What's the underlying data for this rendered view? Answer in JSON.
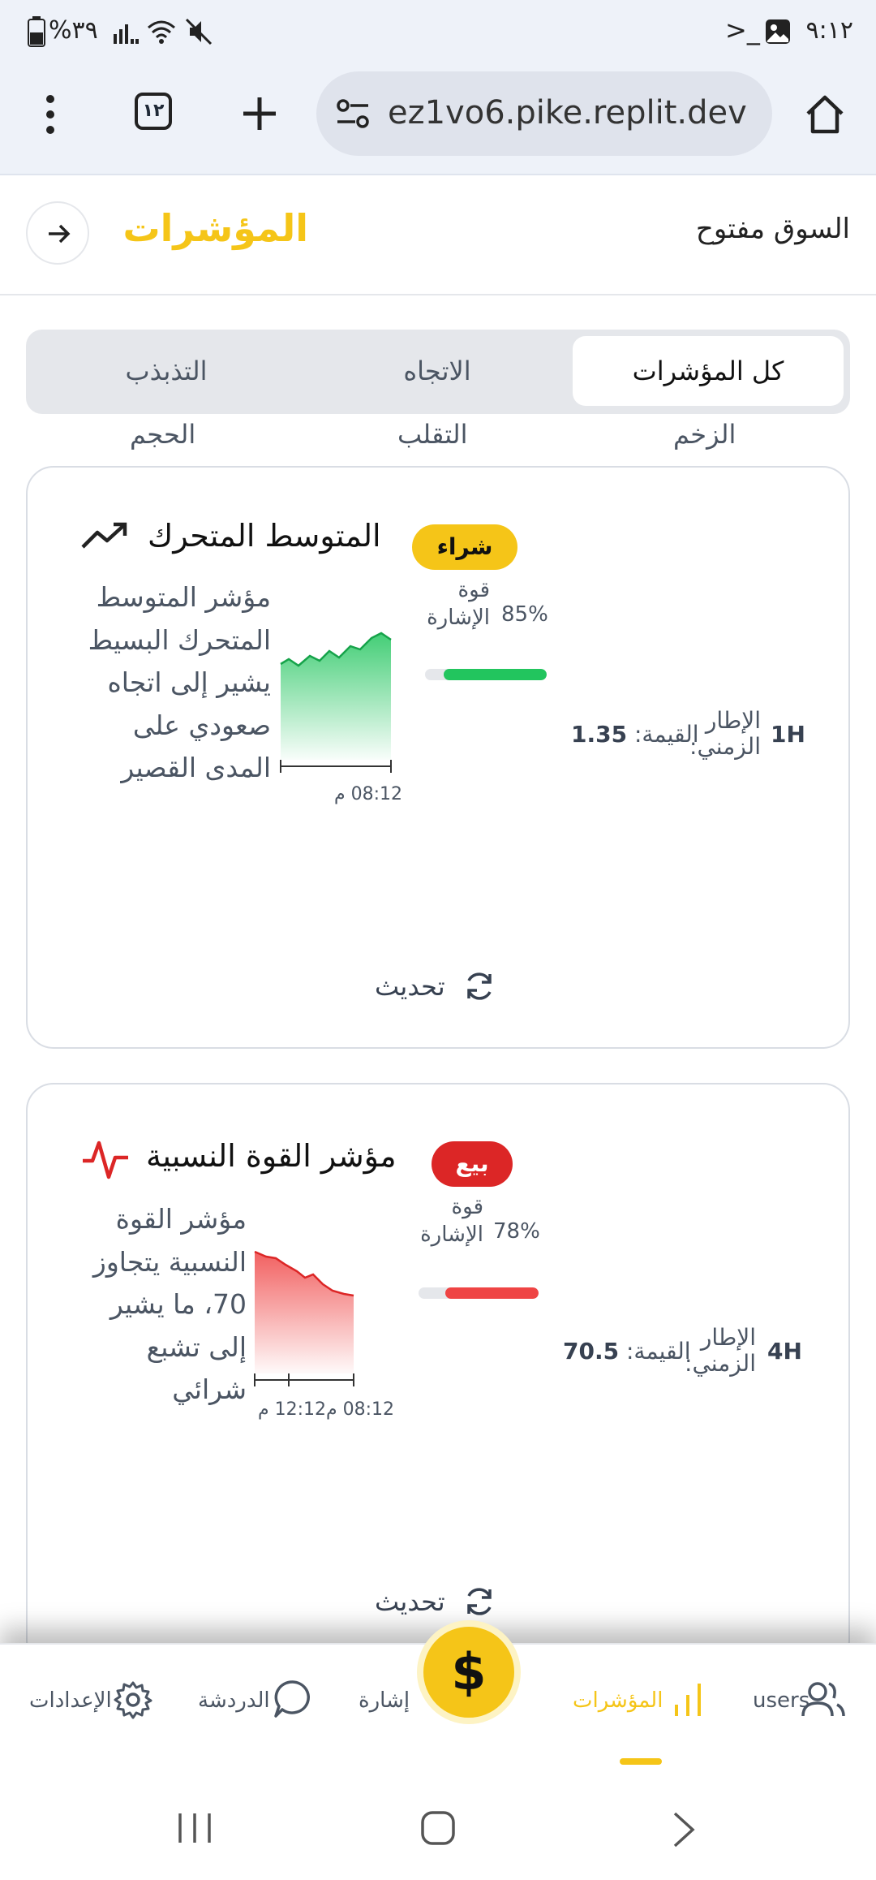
{
  "status_bar": {
    "time": "٩:١٢",
    "battery": "%٣٩"
  },
  "browser": {
    "url": "ez1vo6.pike.replit.dev",
    "tab_count": "١٢"
  },
  "header": {
    "title": "المؤشرات",
    "market_status": "السوق مفتوح"
  },
  "tabs": [
    {
      "label": "كل المؤشرات",
      "active": true
    },
    {
      "label": "الاتجاه",
      "active": false
    },
    {
      "label": "التذبذب",
      "active": false
    }
  ],
  "tabs_row2": [
    {
      "label": "الزخم"
    },
    {
      "label": "التقلب"
    },
    {
      "label": "الحجم"
    }
  ],
  "cards": [
    {
      "title": "المتوسط المتحرك",
      "badge": "شراء",
      "badge_color": "#f5c518",
      "description": "مؤشر المتوسط المتحرك البسيط يشير إلى اتجاه صعودي على المدى القصير",
      "strength_label": "قوة الإشارة",
      "strength_pct": "85%",
      "strength_value": 0.85,
      "strength_color": "#22c55e",
      "value_label": "القيمة:",
      "value": "1.35",
      "timeframe_label": "الإطار الزمني:",
      "timeframe": "1H",
      "chart_times": [
        "08:12 م"
      ],
      "refresh_label": "تحديث"
    },
    {
      "title": "مؤشر القوة النسبية",
      "badge": "بيع",
      "badge_color": "#dc2626",
      "description": "مؤشر القوة النسبية يتجاوز 70، ما يشير إلى تشبع شرائي",
      "strength_label": "قوة الإشارة",
      "strength_pct": "78%",
      "strength_value": 0.78,
      "strength_color": "#ef4444",
      "value_label": "القيمة:",
      "value": "70.5",
      "timeframe_label": "الإطار الزمني:",
      "timeframe": "4H",
      "chart_times": [
        "08:12 م",
        "12:12 م"
      ],
      "refresh_label": "تحديث"
    }
  ],
  "bottom_nav": {
    "users": "users",
    "indicators": "المؤشرات",
    "signal": "إشارة",
    "chat": "الدردشة",
    "settings": "الإعدادات",
    "fab_symbol": "$"
  },
  "colors": {
    "accent": "#f5c518",
    "buy": "#22c55e",
    "sell": "#ef4444"
  }
}
